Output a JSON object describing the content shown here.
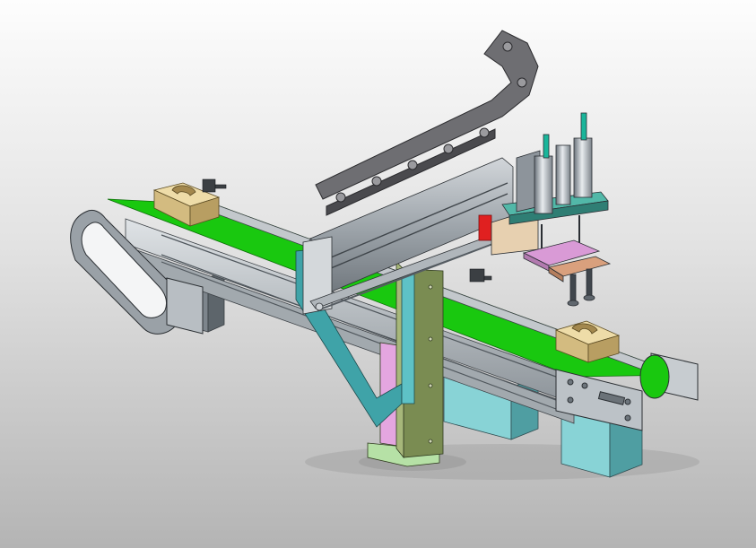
{
  "scene": {
    "kind": "cad-render",
    "colors": {
      "belt": "#19c80f",
      "frame": "#b9bfc4",
      "column": "#7a8c52",
      "bracket": "#3fa3a8",
      "base": "#7fcfd2",
      "box": "#d8c18a",
      "chain": "#6e6e72",
      "cylinder": "#9aa3ab",
      "tube": "#1ab59a",
      "plate_pink": "#d99ad6",
      "plate_tan": "#d9a07d",
      "accent_red": "#e02020"
    }
  }
}
